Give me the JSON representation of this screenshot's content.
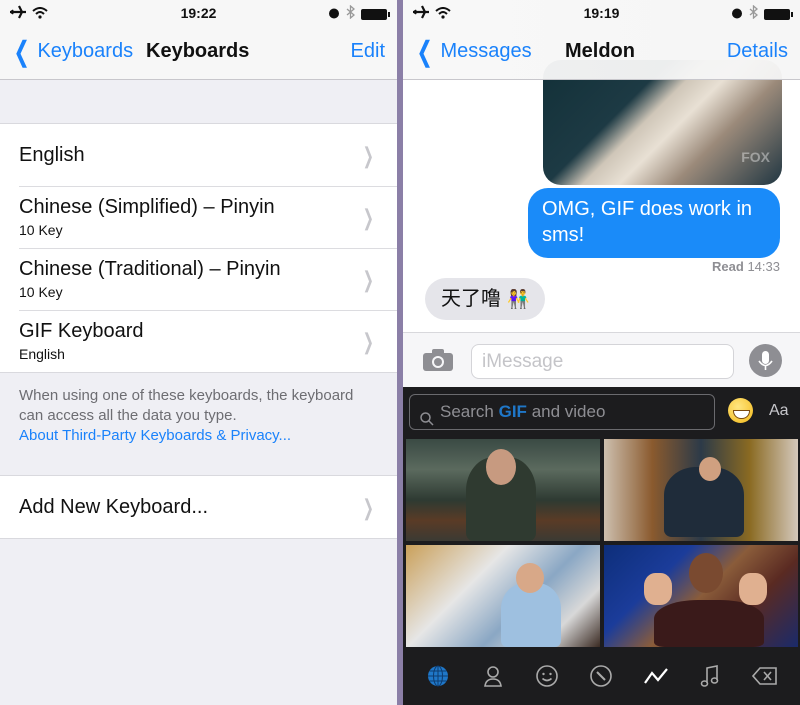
{
  "left": {
    "status": {
      "time": "19:22"
    },
    "nav": {
      "back_label": "Keyboards",
      "title": "Keyboards",
      "right_label": "Edit"
    },
    "keyboards": [
      {
        "title": "English",
        "subtitle": ""
      },
      {
        "title": "Chinese (Simplified) – Pinyin",
        "subtitle": "10 Key"
      },
      {
        "title": "Chinese (Traditional) – Pinyin",
        "subtitle": "10 Key"
      },
      {
        "title": "GIF Keyboard",
        "subtitle": "English"
      }
    ],
    "footer_note": "When using one of these keyboards, the keyboard can access all the data you type.",
    "footer_link": "About Third-Party Keyboards & Privacy...",
    "add_keyboard_label": "Add New Keyboard..."
  },
  "right": {
    "status": {
      "time": "19:19"
    },
    "nav": {
      "back_label": "Messages",
      "title": "Meldon",
      "right_label": "Details"
    },
    "messages": {
      "gif_watermark": "FOX",
      "outgoing_text": "OMG, GIF does work in sms!",
      "read_label": "Read",
      "read_time": "14:33",
      "incoming_text": "天了噜",
      "incoming_emoji": "👫"
    },
    "input": {
      "placeholder": "iMessage"
    },
    "keyboard": {
      "search_prefix": "Search",
      "search_brand": "GIF",
      "search_suffix": "and video",
      "aa_label": "Aa",
      "tabs": [
        "globe",
        "person",
        "smiley",
        "compass",
        "trending",
        "music",
        "delete"
      ],
      "active_tab": "globe",
      "accent_color": "#1f77c8"
    }
  },
  "colors": {
    "ios_blue": "#1a82fb",
    "bubble_out": "#1a8bf9",
    "bubble_in": "#e5e5ea",
    "divider": "#8b7fa7"
  }
}
